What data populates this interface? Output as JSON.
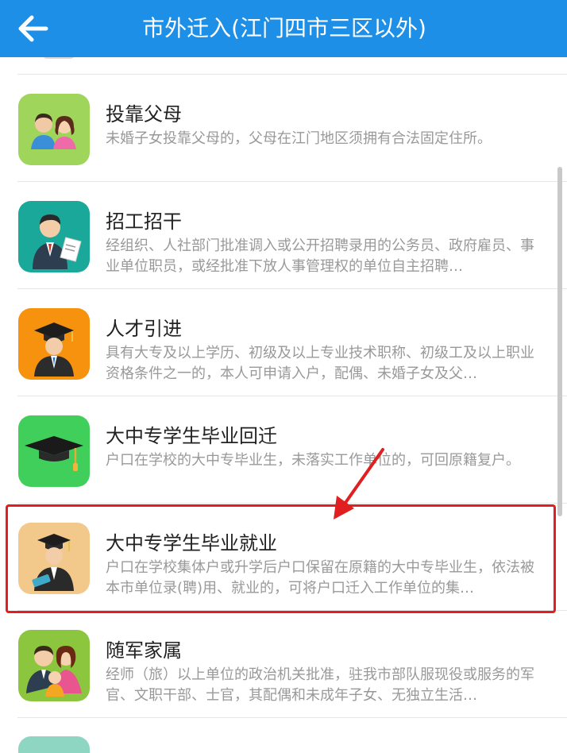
{
  "header": {
    "title": "市外迁入(江门四市三区以外)",
    "background": "#1e8fe6"
  },
  "items": [
    {
      "name": "投靠父母",
      "desc": "未婚子女投靠父母的，父母在江门地区须拥有合法固定住所。",
      "icon": "parents-icon",
      "icon_bg": "#9fd55a"
    },
    {
      "name": "招工招干",
      "desc": "经组织、人社部门批准调入或公开招聘录用的公务员、政府雇员、事业单位职员，或经批准下放人事管理权的单位自主招聘…",
      "icon": "recruitment-icon",
      "icon_bg": "#1aa89a"
    },
    {
      "name": "人才引进",
      "desc": "具有大专及以上学历、初级及以上专业技术职称、初级工及以上职业资格条件之一的，本人可申请入户，配偶、未婚子女及父…",
      "icon": "talent-icon",
      "icon_bg": "#f7920f"
    },
    {
      "name": "大中专学生毕业回迁",
      "desc": "户口在学校的大中专毕业生，未落实工作单位的，可回原籍复户。",
      "icon": "graduation-cap-icon",
      "icon_bg": "#3fcf5a"
    },
    {
      "name": "大中专学生毕业就业",
      "desc": "户口在学校集体户或升学后户口保留在原籍的大中专毕业生，依法被本市单位录(聘)用、就业的，可将户口迁入工作单位的集…",
      "icon": "graduate-employment-icon",
      "icon_bg": "#f2c98a"
    },
    {
      "name": "随军家属",
      "desc": "经师（旅）以上单位的政治机关批准，驻我市部队服现役或服务的军官、文职干部、士官，其配偶和未成年子女、无独立生活…",
      "icon": "military-family-icon",
      "icon_bg": "#8cc63f"
    }
  ],
  "annotation": {
    "highlight_color": "#e02020",
    "highlighted_item": 4
  }
}
